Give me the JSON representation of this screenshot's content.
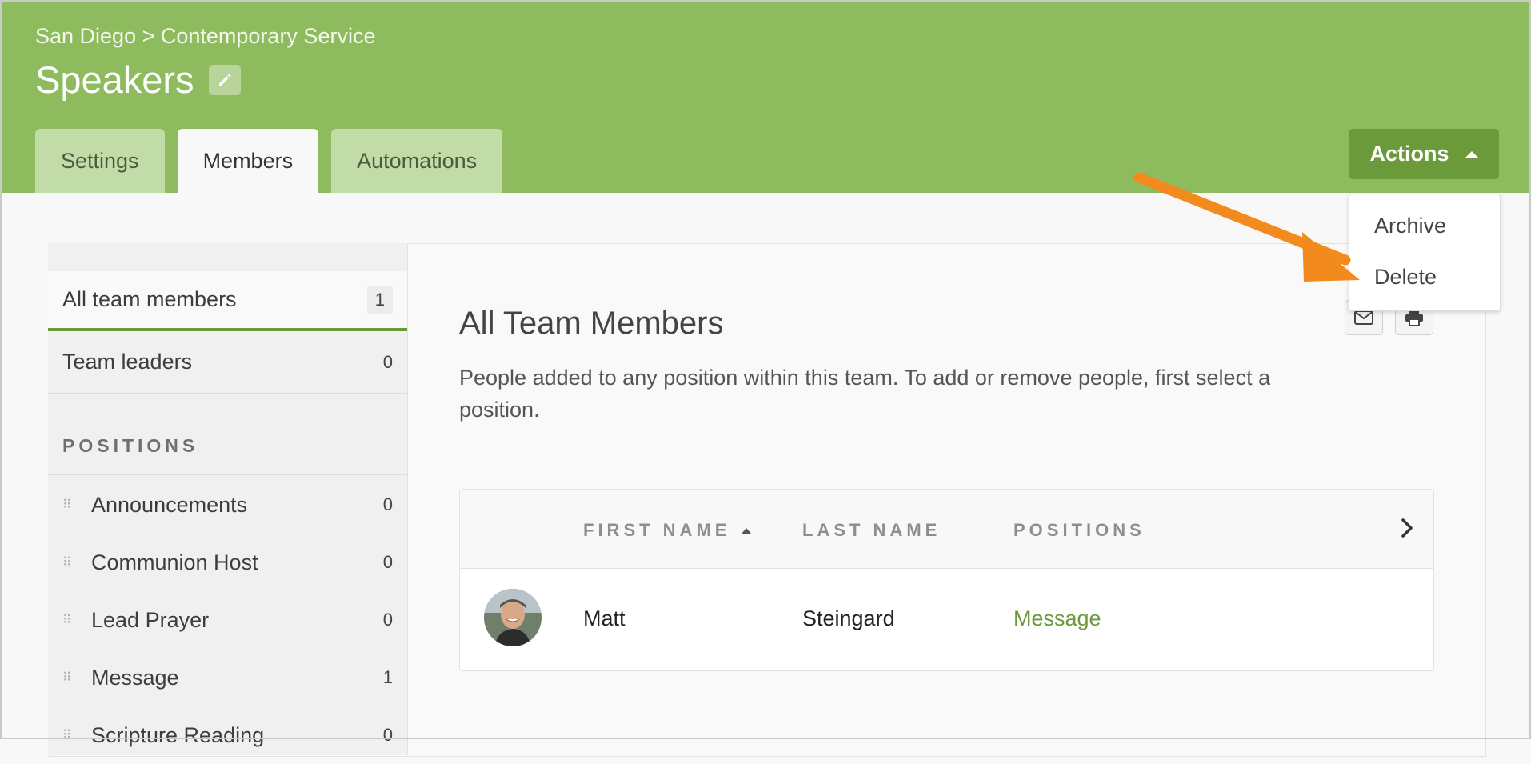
{
  "header": {
    "breadcrumb": "San Diego > Contemporary Service",
    "title": "Speakers",
    "tabs": [
      {
        "label": "Settings",
        "active": false
      },
      {
        "label": "Members",
        "active": true
      },
      {
        "label": "Automations",
        "active": false
      }
    ],
    "actions_label": "Actions",
    "accent_color": "#8fbb5f"
  },
  "actions_menu": {
    "items": [
      "Archive",
      "Delete"
    ]
  },
  "sidebar": {
    "filters": [
      {
        "label": "All team members",
        "count": "1"
      },
      {
        "label": "Team leaders",
        "count": "0"
      }
    ],
    "positions_heading": "POSITIONS",
    "positions": [
      {
        "label": "Announcements",
        "count": "0"
      },
      {
        "label": "Communion Host",
        "count": "0"
      },
      {
        "label": "Lead Prayer",
        "count": "0"
      },
      {
        "label": "Message",
        "count": "1"
      },
      {
        "label": "Scripture Reading",
        "count": "0"
      }
    ]
  },
  "main": {
    "title": "All Team Members",
    "description": "People added to any position within this team. To add or remove people, first select a position.",
    "table": {
      "columns": [
        "FIRST NAME",
        "LAST NAME",
        "POSITIONS"
      ],
      "rows": [
        {
          "first_name": "Matt",
          "last_name": "Steingard",
          "positions": "Message"
        }
      ]
    }
  }
}
